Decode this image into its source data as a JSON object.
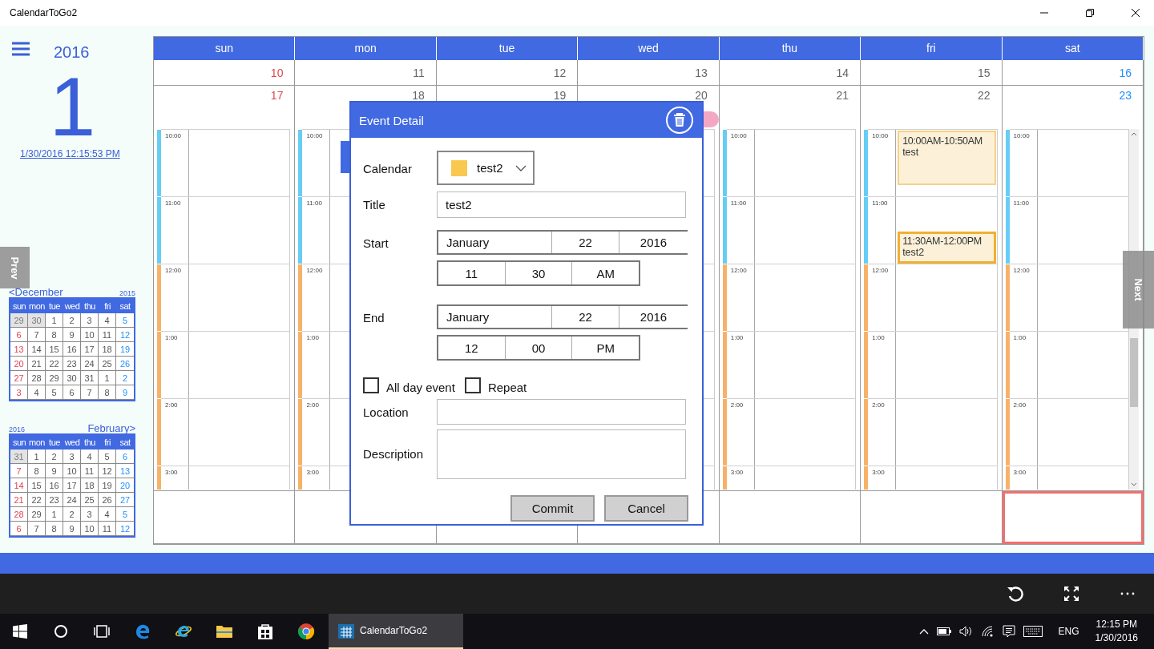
{
  "window": {
    "title": "CalendarToGo2"
  },
  "sidebar": {
    "year": "2016",
    "day": "1",
    "datetime_link": "1/30/2016 12:15:53 PM",
    "prev_tab": "Prev",
    "mini_calendars": [
      {
        "header": [
          {
            "kind": "month",
            "text": "<December"
          },
          {
            "kind": "year",
            "text": "2015"
          }
        ],
        "weekdays": [
          "sun",
          "mon",
          "tue",
          "wed",
          "thu",
          "fri",
          "sat"
        ],
        "weeks": [
          {
            "days": [
              {
                "day": "29",
                "dimmed": true
              },
              {
                "day": "30",
                "dimmed": true
              },
              {
                "day": "1",
                "dimmed": false
              },
              {
                "day": "2",
                "dimmed": false
              },
              {
                "day": "3",
                "dimmed": false
              },
              {
                "day": "4",
                "dimmed": false
              },
              {
                "day": "5",
                "dimmed": false
              }
            ]
          },
          {
            "days": [
              {
                "day": "6",
                "dimmed": false
              },
              {
                "day": "7",
                "dimmed": false
              },
              {
                "day": "8",
                "dimmed": false
              },
              {
                "day": "9",
                "dimmed": false
              },
              {
                "day": "10",
                "dimmed": false
              },
              {
                "day": "11",
                "dimmed": false
              },
              {
                "day": "12",
                "dimmed": false
              }
            ]
          },
          {
            "days": [
              {
                "day": "13",
                "dimmed": false
              },
              {
                "day": "14",
                "dimmed": false
              },
              {
                "day": "15",
                "dimmed": false
              },
              {
                "day": "16",
                "dimmed": false
              },
              {
                "day": "17",
                "dimmed": false
              },
              {
                "day": "18",
                "dimmed": false
              },
              {
                "day": "19",
                "dimmed": false
              }
            ]
          },
          {
            "days": [
              {
                "day": "20",
                "dimmed": false
              },
              {
                "day": "21",
                "dimmed": false
              },
              {
                "day": "22",
                "dimmed": false
              },
              {
                "day": "23",
                "dimmed": false
              },
              {
                "day": "24",
                "dimmed": false
              },
              {
                "day": "25",
                "dimmed": false
              },
              {
                "day": "26",
                "dimmed": false
              }
            ]
          },
          {
            "days": [
              {
                "day": "27",
                "dimmed": false
              },
              {
                "day": "28",
                "dimmed": false
              },
              {
                "day": "29",
                "dimmed": false
              },
              {
                "day": "30",
                "dimmed": false
              },
              {
                "day": "31",
                "dimmed": false
              },
              {
                "day": "1",
                "dimmed": false
              },
              {
                "day": "2",
                "dimmed": false
              }
            ]
          },
          {
            "days": [
              {
                "day": "3",
                "dimmed": false
              },
              {
                "day": "4",
                "dimmed": false
              },
              {
                "day": "5",
                "dimmed": false
              },
              {
                "day": "6",
                "dimmed": false
              },
              {
                "day": "7",
                "dimmed": false
              },
              {
                "day": "8",
                "dimmed": false
              },
              {
                "day": "9",
                "dimmed": false
              }
            ]
          }
        ]
      },
      {
        "header": [
          {
            "kind": "year",
            "text": "2016"
          },
          {
            "kind": "month",
            "text": "February>"
          }
        ],
        "weekdays": [
          "sun",
          "mon",
          "tue",
          "wed",
          "thu",
          "fri",
          "sat"
        ],
        "weeks": [
          {
            "days": [
              {
                "day": "31",
                "dimmed": true
              },
              {
                "day": "1",
                "dimmed": false
              },
              {
                "day": "2",
                "dimmed": false
              },
              {
                "day": "3",
                "dimmed": false
              },
              {
                "day": "4",
                "dimmed": false
              },
              {
                "day": "5",
                "dimmed": false
              },
              {
                "day": "6",
                "dimmed": false
              }
            ]
          },
          {
            "days": [
              {
                "day": "7",
                "dimmed": false
              },
              {
                "day": "8",
                "dimmed": false
              },
              {
                "day": "9",
                "dimmed": false
              },
              {
                "day": "10",
                "dimmed": false
              },
              {
                "day": "11",
                "dimmed": false
              },
              {
                "day": "12",
                "dimmed": false
              },
              {
                "day": "13",
                "dimmed": false
              }
            ]
          },
          {
            "days": [
              {
                "day": "14",
                "dimmed": false
              },
              {
                "day": "15",
                "dimmed": false
              },
              {
                "day": "16",
                "dimmed": false
              },
              {
                "day": "17",
                "dimmed": false
              },
              {
                "day": "18",
                "dimmed": false
              },
              {
                "day": "19",
                "dimmed": false
              },
              {
                "day": "20",
                "dimmed": false
              }
            ]
          },
          {
            "days": [
              {
                "day": "21",
                "dimmed": false
              },
              {
                "day": "22",
                "dimmed": false
              },
              {
                "day": "23",
                "dimmed": false
              },
              {
                "day": "24",
                "dimmed": false
              },
              {
                "day": "25",
                "dimmed": false
              },
              {
                "day": "26",
                "dimmed": false
              },
              {
                "day": "27",
                "dimmed": false
              }
            ]
          },
          {
            "days": [
              {
                "day": "28",
                "dimmed": false
              },
              {
                "day": "29",
                "dimmed": false
              },
              {
                "day": "1",
                "dimmed": false
              },
              {
                "day": "2",
                "dimmed": false
              },
              {
                "day": "3",
                "dimmed": false
              },
              {
                "day": "4",
                "dimmed": false
              },
              {
                "day": "5",
                "dimmed": false
              }
            ]
          },
          {
            "days": [
              {
                "day": "6",
                "dimmed": false
              },
              {
                "day": "7",
                "dimmed": false
              },
              {
                "day": "8",
                "dimmed": false
              },
              {
                "day": "9",
                "dimmed": false
              },
              {
                "day": "10",
                "dimmed": false
              },
              {
                "day": "11",
                "dimmed": false
              },
              {
                "day": "12",
                "dimmed": false
              }
            ]
          }
        ]
      }
    ]
  },
  "week_view": {
    "weekdays": [
      "sun",
      "mon",
      "tue",
      "wed",
      "thu",
      "fri",
      "sat"
    ],
    "week_dates": [
      "10",
      "11",
      "12",
      "13",
      "14",
      "15",
      "16"
    ],
    "days": [
      {
        "date": "17",
        "hours": [
          {
            "label": "10:00",
            "color": "#66cdf5"
          },
          {
            "label": "11:00",
            "color": "#66cdf5"
          },
          {
            "label": "12:00",
            "color": "#f7b26a"
          },
          {
            "label": "1:00",
            "color": "#f7b26a"
          },
          {
            "label": "2:00",
            "color": "#f7b26a"
          },
          {
            "label": "3:00",
            "color": "#f7b26a"
          }
        ]
      },
      {
        "date": "18",
        "hours": [
          {
            "label": "10:00",
            "color": "#66cdf5"
          },
          {
            "label": "11:00",
            "color": "#66cdf5"
          },
          {
            "label": "12:00",
            "color": "#f7b26a"
          },
          {
            "label": "1:00",
            "color": "#f7b26a"
          },
          {
            "label": "2:00",
            "color": "#f7b26a"
          },
          {
            "label": "3:00",
            "color": "#f7b26a"
          }
        ],
        "marks": [
          {
            "kind": "timed",
            "color": "#4169e1"
          }
        ]
      },
      {
        "date": "19"
      },
      {
        "date": "20",
        "marks": [
          {
            "kind": "all_day",
            "color": "#f4a7c3"
          }
        ]
      },
      {
        "date": "21",
        "hours": [
          {
            "label": "10:00",
            "color": "#66cdf5"
          },
          {
            "label": "11:00",
            "color": "#66cdf5"
          },
          {
            "label": "12:00",
            "color": "#f7b26a"
          },
          {
            "label": "1:00",
            "color": "#f7b26a"
          },
          {
            "label": "2:00",
            "color": "#f7b26a"
          },
          {
            "label": "3:00",
            "color": "#f7b26a"
          }
        ]
      },
      {
        "date": "22",
        "hours": [
          {
            "label": "10:00",
            "color": "#66cdf5"
          },
          {
            "label": "11:00",
            "color": "#66cdf5"
          },
          {
            "label": "12:00",
            "color": "#f7b26a"
          },
          {
            "label": "1:00",
            "color": "#f7b26a"
          },
          {
            "label": "2:00",
            "color": "#f7b26a"
          },
          {
            "label": "3:00",
            "color": "#f7b26a"
          }
        ],
        "events": [
          {
            "time": "10:00AM-10:50AM",
            "title": "test",
            "selected": false
          },
          {
            "time": "11:30AM-12:00PM",
            "title": "test2",
            "selected": true
          }
        ]
      },
      {
        "date": "23",
        "hours": [
          {
            "label": "10:00",
            "color": "#66cdf5"
          },
          {
            "label": "11:00",
            "color": "#66cdf5"
          },
          {
            "label": "12:00",
            "color": "#f7b26a"
          },
          {
            "label": "1:00",
            "color": "#f7b26a"
          },
          {
            "label": "2:00",
            "color": "#f7b26a"
          },
          {
            "label": "3:00",
            "color": "#f7b26a"
          }
        ]
      }
    ],
    "bottom_cells": [
      {
        "selected": false
      },
      {
        "selected": false
      },
      {
        "selected": false
      },
      {
        "selected": false
      },
      {
        "selected": false
      },
      {
        "selected": false
      },
      {
        "selected": true
      }
    ],
    "next_tab": "Next"
  },
  "dialog": {
    "title": "Event Detail",
    "calendar": {
      "label": "Calendar",
      "value": "test2",
      "color": "#f9c84e"
    },
    "title_field": {
      "label": "Title",
      "value": "test2"
    },
    "start": {
      "label": "Start",
      "month": "January",
      "day": "22",
      "year": "2016",
      "hour": "11",
      "minute": "30",
      "ampm": "AM"
    },
    "end": {
      "label": "End",
      "month": "January",
      "day": "22",
      "year": "2016",
      "hour": "12",
      "minute": "00",
      "ampm": "PM"
    },
    "checkboxes": [
      {
        "label": "All day event",
        "checked": false
      },
      {
        "label": "Repeat",
        "checked": false
      }
    ],
    "location": {
      "label": "Location"
    },
    "description": {
      "label": "Description"
    },
    "buttons": [
      "Commit",
      "Cancel"
    ]
  },
  "taskbar": {
    "running_app": {
      "label": "CalendarToGo2",
      "active": true
    },
    "language": "ENG",
    "time": "12:15 PM",
    "date": "1/30/2016"
  }
}
